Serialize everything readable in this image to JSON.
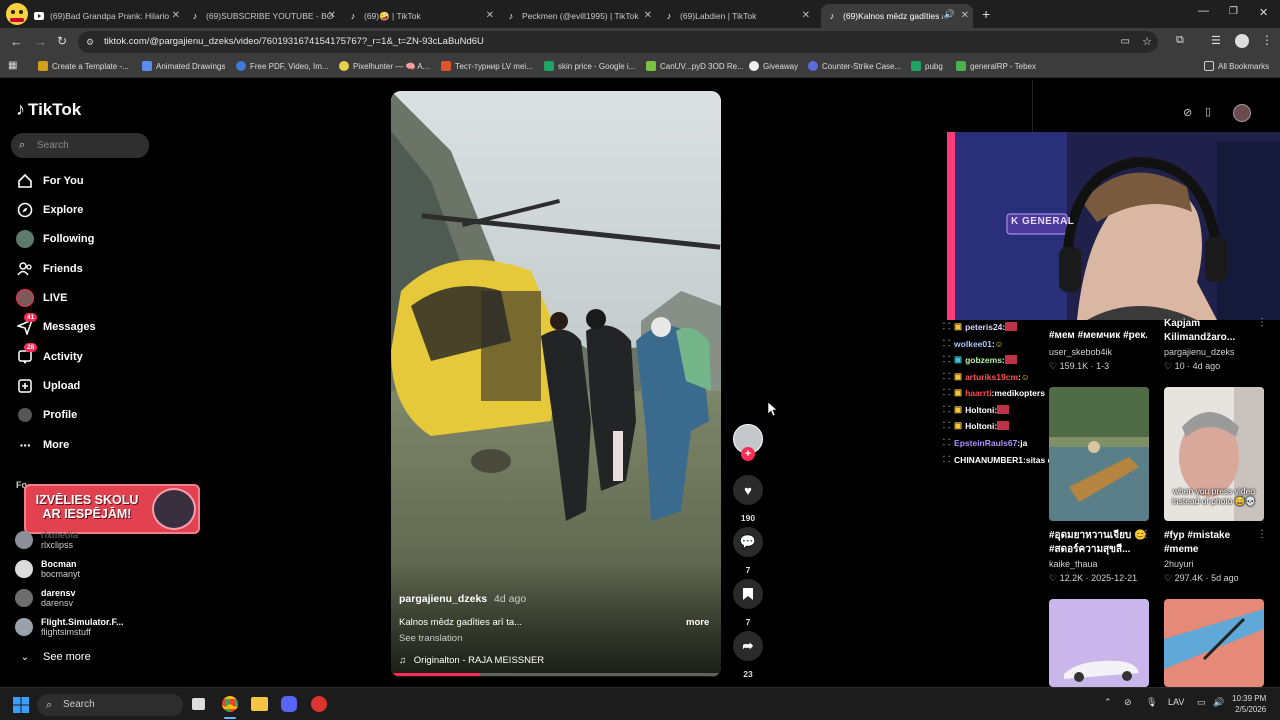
{
  "tabs": [
    {
      "label": "(69)Bad Grandpa Prank: Hilario"
    },
    {
      "label": "(69)SUBSCRIBE YOUTUBE - BO"
    },
    {
      "label": "(69)🤪 | TikTok"
    },
    {
      "label": "Peckmen (@evill1995) | TikTok"
    },
    {
      "label": "(69)Labdien | TikTok"
    },
    {
      "label": "(69)Kalnos mēdz gadīties a"
    }
  ],
  "address": {
    "url": "tiktok.com/@pargajienu_dzeks/video/7601931674154175767?_r=1&_t=ZN-93cLaBuNd6U"
  },
  "bookmarks": [
    {
      "label": "Create a Template -...",
      "color": "#d4a017"
    },
    {
      "label": "Animated Drawings",
      "color": "#5b8def"
    },
    {
      "label": "Free PDF, Video, Im...",
      "color": "#3d7bd9"
    },
    {
      "label": "Pixelhunter — 🧠 A...",
      "color": "#e6d14a"
    },
    {
      "label": "Тест-турнир LV mei...",
      "color": "#e0542d"
    },
    {
      "label": "skin price - Google i...",
      "color": "#1fa463"
    },
    {
      "label": "CanUV...pyD 3OD Re...",
      "color": "#7bc142"
    },
    {
      "label": "Giveaway",
      "color": "#f0f0f0"
    },
    {
      "label": "Counter-Strike Case...",
      "color": "#5a6ad8"
    },
    {
      "label": "pubg",
      "color": "#1fa463"
    },
    {
      "label": "generalRP - Tebex",
      "color": "#4caf50"
    }
  ],
  "all_bookmarks": "All Bookmarks",
  "sidebar": {
    "logo": "TikTok",
    "search_placeholder": "Search",
    "items": [
      {
        "label": "For You",
        "icon": "home-icon"
      },
      {
        "label": "Explore",
        "icon": "compass-icon"
      },
      {
        "label": "Following",
        "icon": "avatar"
      },
      {
        "label": "Friends",
        "icon": "friends-icon"
      },
      {
        "label": "LIVE",
        "icon": "live-icon"
      },
      {
        "label": "Messages",
        "icon": "messages-icon",
        "badge": "41"
      },
      {
        "label": "Activity",
        "icon": "activity-icon",
        "badge": "28"
      },
      {
        "label": "Upload",
        "icon": "upload-icon"
      },
      {
        "label": "Profile",
        "icon": "profile-icon"
      },
      {
        "label": "More",
        "icon": "more-icon"
      }
    ],
    "following_label": "Fo",
    "overlay_banner": "IZVĒLIES SKOLU AR IESPĒJĀM!",
    "following": [
      {
        "name": "rlxmedia",
        "handle": "rlxclipss"
      },
      {
        "name": "Bocman",
        "handle": "bocmanyt"
      },
      {
        "name": "darensv",
        "handle": "darensv"
      },
      {
        "name": "Flight.Simulator.F...",
        "handle": "flightsimstuff"
      }
    ],
    "see_more": "See more"
  },
  "video": {
    "author": "pargajienu_dzeks",
    "age": "4d ago",
    "caption": "Kalnos mēdz gadīties arī ta...",
    "more": "more",
    "translation": "See translation",
    "sound": "Originalton - RAJA MEISSNER",
    "progress": 0.27
  },
  "actions": {
    "likes": "190",
    "comments": "7",
    "saves": "7",
    "shares": "23"
  },
  "chat": [
    {
      "user": "peteris24",
      "msg": "",
      "color": "#d8d8ff"
    },
    {
      "user": "wolkee01",
      "msg": "",
      "color": "#a7c7ff"
    },
    {
      "user": "gobzems",
      "msg": "",
      "color": "#b6f0a0"
    },
    {
      "user": "arturiks19cm",
      "msg": "",
      "color": "#ff5555"
    },
    {
      "user": "haarrti",
      "msg": "medikopters",
      "color": "#ff4b4b"
    },
    {
      "user": "Holtoni",
      "msg": "",
      "color": "#ffffff"
    },
    {
      "user": "Holtoni",
      "msg": "",
      "color": "#ffffff"
    },
    {
      "user": "EpsteinRauls67",
      "msg": "ja",
      "color": "#b28dff"
    },
    {
      "user": "CHINANUMBER1",
      "msg": "sitas dargs prieks",
      "color": "#ffffff"
    }
  ],
  "cards": [
    {
      "title": "#мем #мемчик #рек...",
      "user": "user_skebob4ik",
      "likes": "159.1K",
      "date": "1-3"
    },
    {
      "title": "Kapjam Kilimandžaro...",
      "user": "pargajienu_dzeks",
      "likes": "10",
      "date": "4d ago"
    },
    {
      "title": "#อุดมยาหวานเจียบ 😊 #สดอร์ความสุขสี...",
      "user": "kaike_thaua",
      "likes": "12.2K",
      "date": "2025-12-21"
    },
    {
      "title": "#fyp #mistake #meme",
      "user": "2huyuri",
      "likes": "297.4K",
      "date": "5d ago",
      "overlay": "when you press video instead of photo 😅💀"
    }
  ],
  "taskbar": {
    "search": "Search",
    "lang": "LAV",
    "time": "10:39 PM",
    "date": "2/5/2026"
  }
}
